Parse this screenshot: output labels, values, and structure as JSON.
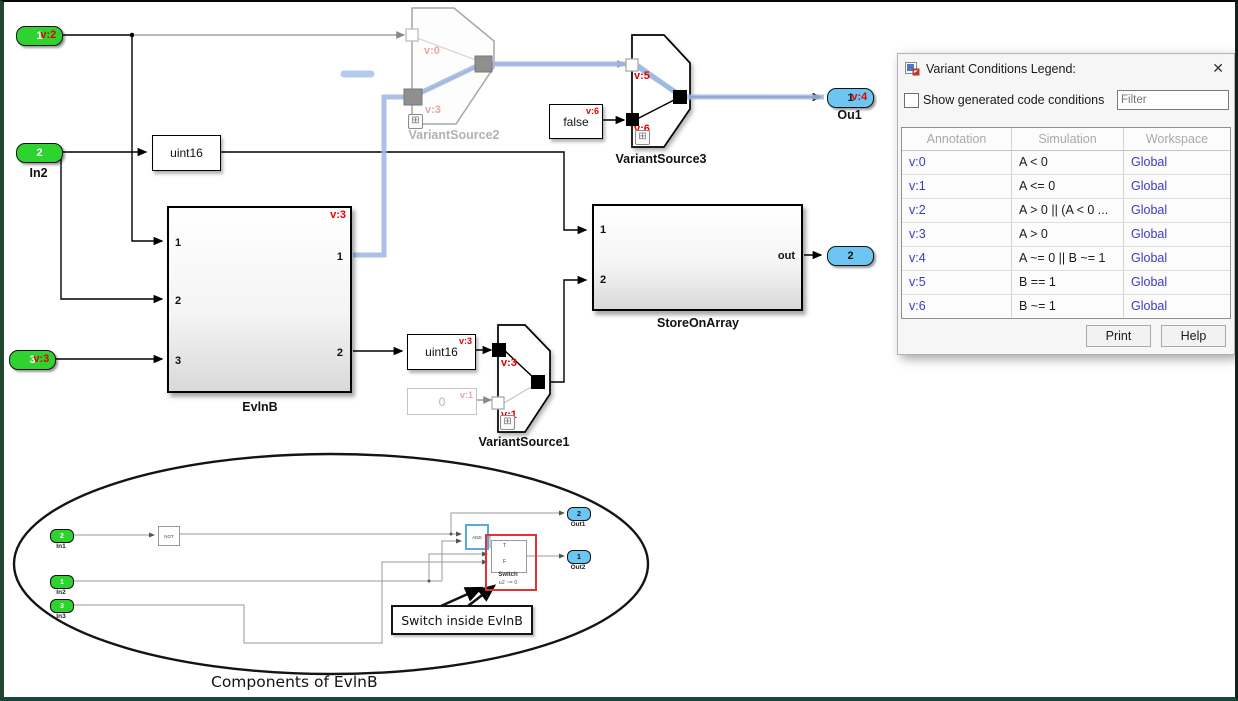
{
  "canvas": {
    "badge_glyph": "⊞",
    "ports": {
      "in1": {
        "num": "1",
        "ann": "v:2"
      },
      "in2": {
        "num": "2",
        "label": "In2"
      },
      "in3": {
        "num": "3",
        "ann": "v:3"
      },
      "out1": {
        "num": "1",
        "ann": "v:4",
        "label": "Ou1"
      },
      "out2": {
        "num": "2"
      }
    },
    "blocks": {
      "uint16_top": {
        "text": "uint16"
      },
      "uint16_bot": {
        "text": "uint16",
        "ann": "v:3"
      },
      "false_const": {
        "text": "false",
        "ann": "v:6"
      },
      "zero_const": {
        "text": "0",
        "ann": "v:1"
      },
      "evlnb": {
        "name": "EvlnB",
        "ann": "v:3",
        "in": [
          "1",
          "2",
          "3"
        ],
        "out": [
          "1",
          "2"
        ]
      },
      "store": {
        "name": "StoreOnArray",
        "in": [
          "1",
          "2"
        ],
        "out": "out"
      },
      "vs1": {
        "name": "VariantSource1",
        "ann_in1": "v:3",
        "ann_in2": "v:1"
      },
      "vs2": {
        "name": "VariantSource2",
        "ann_in1": "v:0",
        "ann_in2": "v:3"
      },
      "vs3": {
        "name": "VariantSource3",
        "ann_in1": "v:5",
        "ann_in2": "v:6"
      }
    },
    "inset": {
      "caption": "Components of EvlnB",
      "callout": "Switch inside EvlnB",
      "in1": {
        "num": "2",
        "label": "In1"
      },
      "in2": {
        "num": "1",
        "label": "In2"
      },
      "in3": {
        "num": "3",
        "label": "In3"
      },
      "out1": {
        "num": "2",
        "label": "Out1"
      },
      "out2": {
        "num": "1",
        "label": "Out2"
      },
      "not_label": "NOT",
      "and_label": "AND",
      "switch": {
        "name": "Switch",
        "cond": "u2 ~= 0",
        "t": "T",
        "f": "F"
      }
    }
  },
  "legend": {
    "title": "Variant Conditions Legend:",
    "close": "✕",
    "checkbox_label": "Show generated code conditions",
    "filter_placeholder": "Filter",
    "columns": [
      "Annotation",
      "Simulation",
      "Workspace"
    ],
    "rows": [
      {
        "a": "v:0",
        "s": "A < 0",
        "w": "Global"
      },
      {
        "a": "v:1",
        "s": "A <= 0",
        "w": "Global"
      },
      {
        "a": "v:2",
        "s": "A > 0 || (A < 0 ...",
        "w": "Global"
      },
      {
        "a": "v:3",
        "s": "A > 0",
        "w": "Global"
      },
      {
        "a": "v:4",
        "s": "A ~= 0 || B ~= 1",
        "w": "Global"
      },
      {
        "a": "v:5",
        "s": "B == 1",
        "w": "Global"
      },
      {
        "a": "v:6",
        "s": "B ~= 1",
        "w": "Global"
      }
    ],
    "print": "Print",
    "help": "Help"
  }
}
